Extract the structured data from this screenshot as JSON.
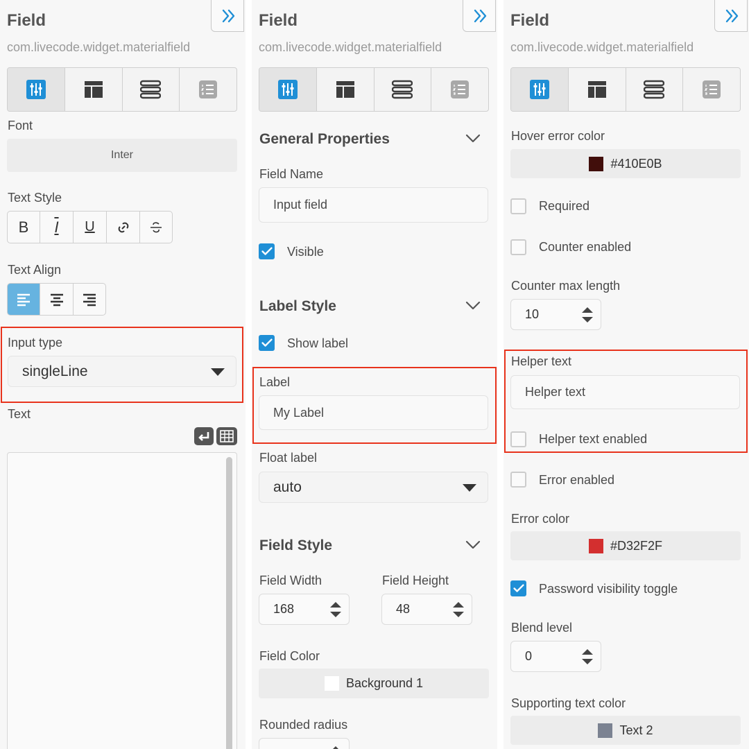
{
  "colors": {
    "accent": "#1f8fd6",
    "highlight": "#e8331c"
  },
  "panels": {
    "left": {
      "title": "Field",
      "subtitle": "com.livecode.widget.materialfield",
      "font_label_partial": "Font",
      "font_value": "Inter",
      "text_style_label": "Text Style",
      "text_style_buttons": [
        "B",
        "I",
        "U",
        "link-icon",
        "strikethrough-icon"
      ],
      "text_align_label": "Text Align",
      "input_type_label": "Input type",
      "input_type_value": "singleLine",
      "text_label": "Text"
    },
    "middle": {
      "title": "Field",
      "subtitle": "com.livecode.widget.materialfield",
      "general_properties": "General Properties",
      "field_name_label": "Field Name",
      "field_name_value": "Input field",
      "visible_label": "Visible",
      "label_style": "Label Style",
      "show_label": "Show label",
      "label_label": "Label",
      "label_value": "My Label",
      "float_label_label": "Float label",
      "float_label_value": "auto",
      "field_style": "Field Style",
      "field_width_label": "Field Width",
      "field_width_value": "168",
      "field_height_label": "Field Height",
      "field_height_value": "48",
      "field_color_label": "Field Color",
      "field_color_value": "Background 1",
      "field_color_swatch": "#ffffff",
      "rounded_radius_label": "Rounded radius"
    },
    "right": {
      "title": "Field",
      "subtitle": "com.livecode.widget.materialfield",
      "hover_error_color_label": "Hover error color",
      "hover_error_color_value": "#410E0B",
      "required_label": "Required",
      "counter_enabled_label": "Counter enabled",
      "counter_max_length_label": "Counter max length",
      "counter_max_length_value": "10",
      "helper_text_label": "Helper text",
      "helper_text_value": "Helper text",
      "helper_text_enabled_label": "Helper text enabled",
      "error_enabled_label": "Error enabled",
      "error_color_label": "Error color",
      "error_color_value": "#D32F2F",
      "password_toggle_label": "Password visibility toggle",
      "blend_level_label": "Blend level",
      "blend_level_value": "0",
      "supporting_text_color_label": "Supporting text color",
      "supporting_text_color_value": "Text 2",
      "supporting_text_color_swatch": "#7b8291"
    }
  }
}
